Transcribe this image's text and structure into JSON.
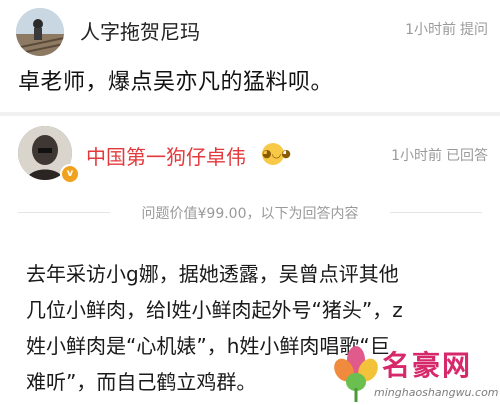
{
  "question": {
    "username": "人字拖贺尼玛",
    "time": "1小时前",
    "action": "提问",
    "text": "卓老师，爆点吴亦凡的猛料呗。"
  },
  "answer": {
    "username": "中国第一狗仔卓伟",
    "time": "1小时前",
    "status": "已回答",
    "price_text": "问题价值¥99.00，以下为回答内容",
    "lines": [
      "去年采访小g娜，据她透露，吴曾点评其他",
      "几位小鲜肉，给l姓小鲜肉起外号“猪头”，z",
      "姓小鲜肉是“心机婊”，h姓小鲜肉唱歌“巨",
      "难听”，而自己鹤立鸡群。"
    ]
  },
  "watermark": {
    "title": "名豪网",
    "url": "minghaoshangwu.com"
  },
  "colors": {
    "accent_red": "#e4393c",
    "meta_gray": "#9a9a9a",
    "badge_orange": "#f0a21e",
    "watermark_pink": "#d6286b"
  }
}
